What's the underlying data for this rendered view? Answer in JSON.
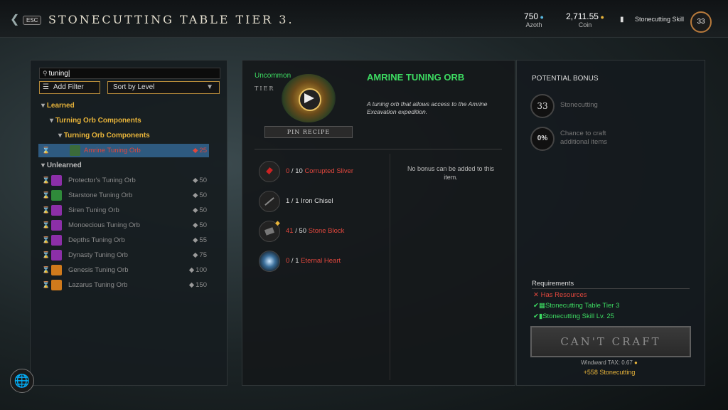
{
  "header": {
    "back_icon": "chevron-left-icon",
    "esc_label": "ESC",
    "title": "STONECUTTING TABLE TIER 3.",
    "azoth_value": "750",
    "azoth_label": "Azoth",
    "coin_value": "2,711.55",
    "coin_label": "Coin",
    "skill_label": "Stonecutting Skill",
    "skill_level": "33"
  },
  "search": {
    "value": "tuning"
  },
  "filters": {
    "add_filter": "Add Filter",
    "sort": "Sort by Level"
  },
  "tree": {
    "learned": "Learned",
    "comp1": "Turning Orb Components",
    "comp2": "Turning Orb Components",
    "unlearned": "Unlearned"
  },
  "recipes_learned": [
    {
      "name": "Amrine Tuning Orb",
      "count": "25"
    }
  ],
  "recipes_unlearned": [
    {
      "name": "Protector's Tuning Orb",
      "count": "50"
    },
    {
      "name": "Starstone Tuning Orb",
      "count": "50"
    },
    {
      "name": "Siren Tuning Orb",
      "count": "50"
    },
    {
      "name": "Monoecious Tuning Orb",
      "count": "50"
    },
    {
      "name": "Depths Tuning Orb",
      "count": "55"
    },
    {
      "name": "Dynasty Tuning Orb",
      "count": "75"
    },
    {
      "name": "Genesis Tuning Orb",
      "count": "100"
    },
    {
      "name": "Lazarus Tuning Orb",
      "count": "150"
    }
  ],
  "item": {
    "rarity": "Uncommon",
    "tier_label": "TIER",
    "name": "AMRINE TUNING ORB",
    "description": "A tuning orb that allows access to the Amrine Excavation expedition.",
    "pin_label": "PIN RECIPE",
    "no_bonus": "No bonus can be added to this item."
  },
  "materials": [
    {
      "have": "0",
      "need": "10",
      "name": "Corrupted Sliver"
    },
    {
      "have": "1",
      "need": "1",
      "name": "Iron Chisel"
    },
    {
      "have": "41",
      "need": "50",
      "name": "Stone Block"
    },
    {
      "have": "0",
      "need": "1",
      "name": "Eternal Heart"
    }
  ],
  "bonus": {
    "title": "POTENTIAL BONUS",
    "level": "33",
    "level_label": "Stonecutting",
    "chance": "0%",
    "chance_label": "Chance to craft additional items"
  },
  "requirements": {
    "title": "Requirements",
    "items": [
      "Has Resources",
      "Stonecutting Table Tier 3",
      "Stonecutting Skill Lv. 25"
    ]
  },
  "craft": {
    "label": "CAN'T CRAFT",
    "tax": "Windward TAX: 0.67",
    "xp": "+558 Stonecutting"
  },
  "colors": {
    "accent_green": "#3ddc62",
    "red": "#e0473d",
    "gold": "#e8b43a",
    "selected": "#2e5a80"
  }
}
